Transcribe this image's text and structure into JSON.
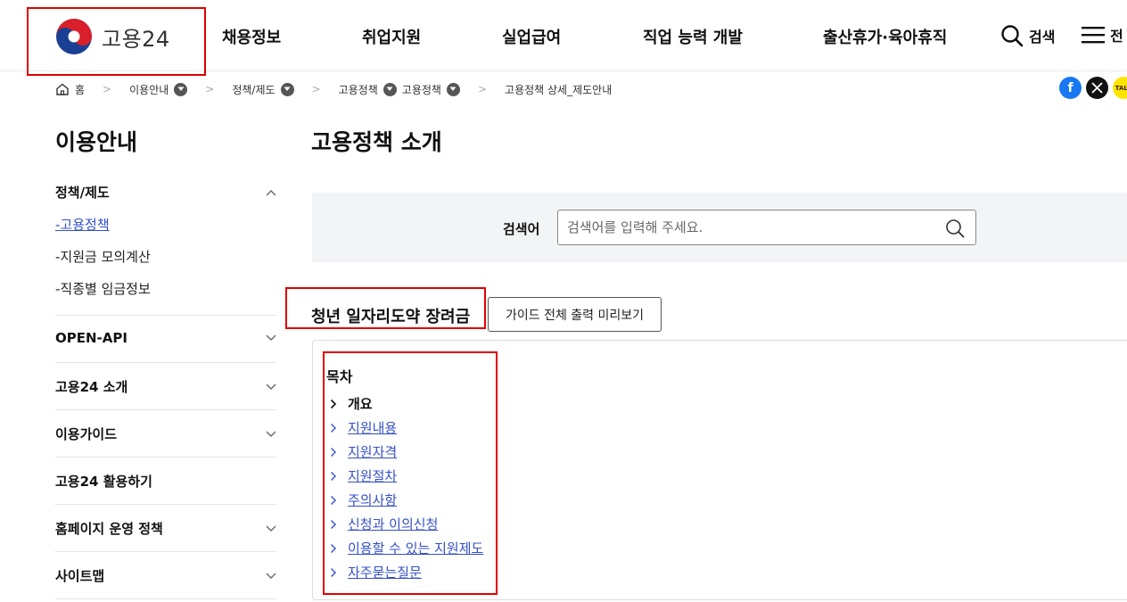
{
  "header": {
    "logo_text": "고용24",
    "nav": [
      "채용정보",
      "취업지원",
      "실업급여",
      "직업 능력 개발",
      "출산휴가·육아휴직"
    ],
    "search_label": "검색",
    "all_menu_label": "전"
  },
  "breadcrumb": {
    "home": "홈",
    "items": [
      "이용안내",
      "정책/제도",
      "고용정책",
      "고용정책",
      "고용정책 상세_제도안내"
    ]
  },
  "share": {
    "kakao_label": "TALK"
  },
  "sidebar": {
    "title": "이용안내",
    "groups": [
      {
        "label": "정책/제도",
        "items": [
          "-고용정책",
          "-지원금 모의계산",
          "-직종별 임금정보"
        ]
      },
      {
        "label": "OPEN-API"
      },
      {
        "label": "고용24 소개"
      },
      {
        "label": "이용가이드"
      },
      {
        "label": "고용24 활용하기"
      },
      {
        "label": "홈페이지 운영 정책"
      },
      {
        "label": "사이트맵"
      }
    ]
  },
  "main": {
    "title": "고용정책 소개",
    "search": {
      "label": "검색어",
      "placeholder": "검색어를 입력해 주세요.",
      "value": ""
    },
    "section_title": "청년 일자리도약 장려금",
    "guide_button": "가이드 전체 출력 미리보기",
    "toc": {
      "title": "목차",
      "items": [
        "개요",
        "지원내용",
        "지원자격",
        "지원절차",
        "주의사항",
        "신청과 이의신청",
        "이용할 수 있는 지원제도",
        "자주묻는질문"
      ]
    }
  },
  "colors": {
    "accent": "#3550c8",
    "highlight": "#e00000",
    "facebook": "#1877f2",
    "kakao": "#fee500"
  }
}
